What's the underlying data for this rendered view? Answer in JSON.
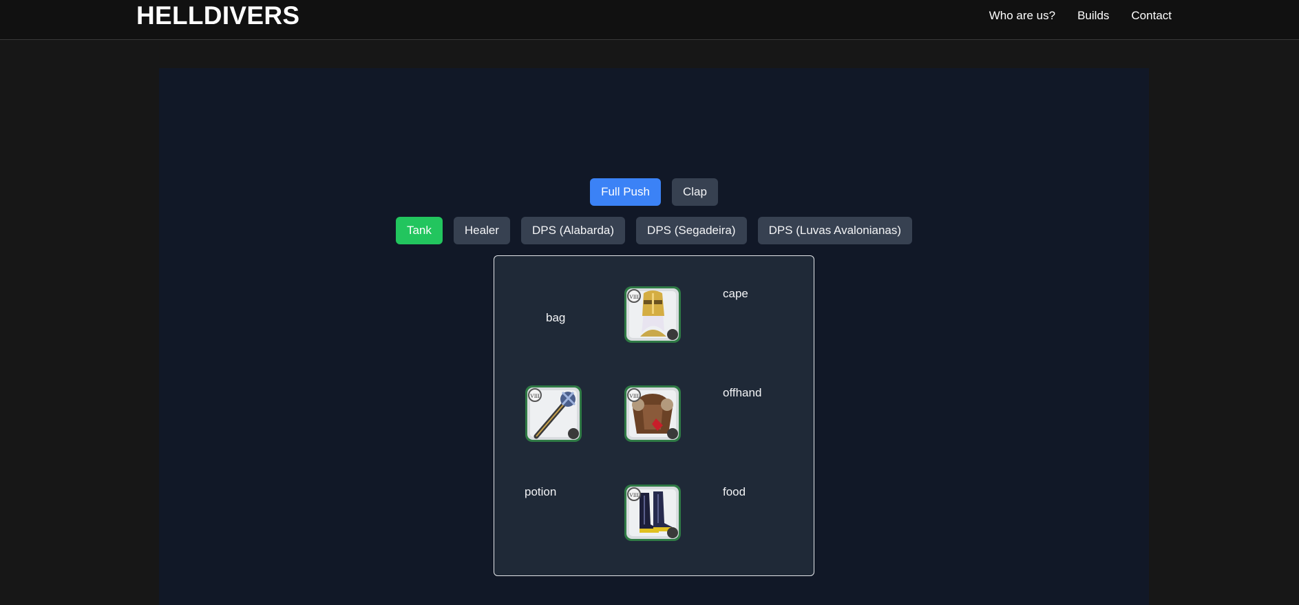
{
  "header": {
    "brand": "HELLDIVERS",
    "nav": [
      "Who are us?",
      "Builds",
      "Contact"
    ]
  },
  "build_types": [
    {
      "label": "Full Push",
      "active": true
    },
    {
      "label": "Clap",
      "active": false
    }
  ],
  "roles": [
    {
      "label": "Tank",
      "active": true
    },
    {
      "label": "Healer",
      "active": false
    },
    {
      "label": "DPS (Alabarda)",
      "active": false
    },
    {
      "label": "DPS (Segadeira)",
      "active": false
    },
    {
      "label": "DPS (Luvas Avalonianas)",
      "active": false
    }
  ],
  "gear": {
    "bag": "bag",
    "cape": "cape",
    "offhand": "offhand",
    "potion": "potion",
    "food": "food",
    "items": {
      "head": {
        "tier": "VIII",
        "icon": "golden-helmet-icon"
      },
      "weapon": {
        "tier": "VIII",
        "icon": "mace-weapon-icon"
      },
      "armor": {
        "tier": "VIII",
        "icon": "armor-chest-icon"
      },
      "shoes": {
        "tier": "VIII",
        "icon": "boots-icon"
      }
    }
  },
  "colors": {
    "accent_blue": "#3b82f6",
    "accent_green": "#22c55e",
    "button_inactive": "#374151",
    "panel_bg": "#111827",
    "gear_bg": "#1f2937"
  }
}
